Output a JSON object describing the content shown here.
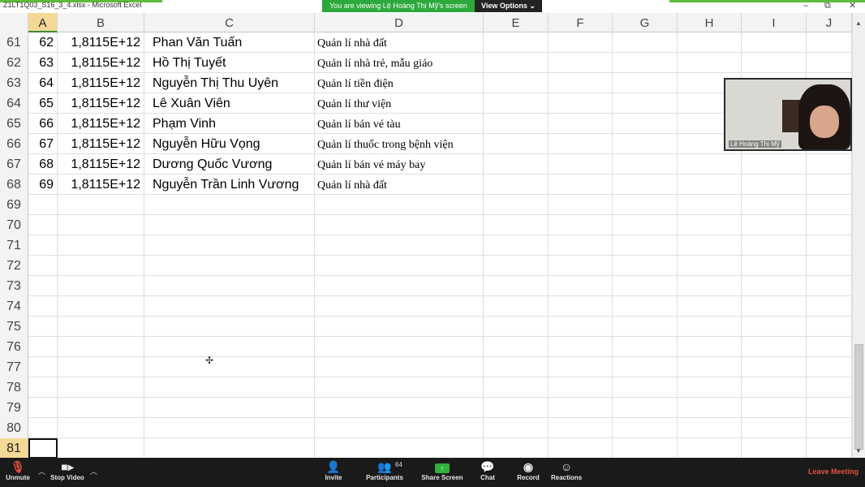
{
  "window": {
    "title": "Z1LT1Q03_S16_3_4.xlsx - Microsoft Excel",
    "viewing_banner": "You are viewing Lệ Hoàng Thị Mỹ's screen",
    "view_options": "View Options ⌄"
  },
  "columns": [
    "A",
    "B",
    "C",
    "D",
    "E",
    "F",
    "G",
    "H",
    "I",
    "J"
  ],
  "active_column": "A",
  "rows": [
    {
      "num": "61",
      "a": "62",
      "b": "1,8115E+12",
      "c": "Phan Văn Tuấn",
      "d": "Quản lí nhà đất"
    },
    {
      "num": "62",
      "a": "63",
      "b": "1,8115E+12",
      "c": "Hồ Thị Tuyết",
      "d": " Quản lí nhà trẻ, mẫu giáo"
    },
    {
      "num": "63",
      "a": "64",
      "b": "1,8115E+12",
      "c": "Nguyễn Thị Thu Uyên",
      "d": " Quản lí tiền điện"
    },
    {
      "num": "64",
      "a": "65",
      "b": "1,8115E+12",
      "c": "Lê Xuân Viên",
      "d": "Quản lí thư viện"
    },
    {
      "num": "65",
      "a": "66",
      "b": "1,8115E+12",
      "c": "Phạm Vinh",
      "d": "Quản lí bán vé tàu"
    },
    {
      "num": "66",
      "a": "67",
      "b": "1,8115E+12",
      "c": "Nguyễn Hữu Vọng",
      "d": "Quản lí thuốc trong bệnh viện"
    },
    {
      "num": "67",
      "a": "68",
      "b": "1,8115E+12",
      "c": "Dương Quốc Vương",
      "d": "Quản lí bán vé máy bay"
    },
    {
      "num": "68",
      "a": "69",
      "b": "1,8115E+12",
      "c": "Nguyễn Trần Linh Vương",
      "d": "Quản lí nhà đất"
    },
    {
      "num": "69",
      "a": "",
      "b": "",
      "c": "",
      "d": ""
    },
    {
      "num": "70",
      "a": "",
      "b": "",
      "c": "",
      "d": ""
    },
    {
      "num": "71",
      "a": "",
      "b": "",
      "c": "",
      "d": ""
    },
    {
      "num": "72",
      "a": "",
      "b": "",
      "c": "",
      "d": ""
    },
    {
      "num": "73",
      "a": "",
      "b": "",
      "c": "",
      "d": ""
    },
    {
      "num": "74",
      "a": "",
      "b": "",
      "c": "",
      "d": ""
    },
    {
      "num": "75",
      "a": "",
      "b": "",
      "c": "",
      "d": ""
    },
    {
      "num": "76",
      "a": "",
      "b": "",
      "c": "",
      "d": ""
    },
    {
      "num": "77",
      "a": "",
      "b": "",
      "c": "",
      "d": ""
    },
    {
      "num": "78",
      "a": "",
      "b": "",
      "c": "",
      "d": ""
    },
    {
      "num": "79",
      "a": "",
      "b": "",
      "c": "",
      "d": ""
    },
    {
      "num": "80",
      "a": "",
      "b": "",
      "c": "",
      "d": ""
    },
    {
      "num": "81",
      "a": "",
      "b": "",
      "c": "",
      "d": ""
    }
  ],
  "active_row": "81",
  "video": {
    "participant_name": "Lệ Hoàng Thị Mỹ"
  },
  "toolbar": {
    "unmute": "Unmute",
    "stop_video": "Stop Video",
    "invite": "Invite",
    "participants": "Participants",
    "participants_count": "64",
    "share_screen": "Share Screen",
    "chat": "Chat",
    "record": "Record",
    "reactions": "Reactions",
    "leave": "Leave Meeting"
  },
  "colors": {
    "zoom_green": "#2ca93a",
    "active_header": "#f4d996",
    "leave_red": "#e0533f"
  }
}
